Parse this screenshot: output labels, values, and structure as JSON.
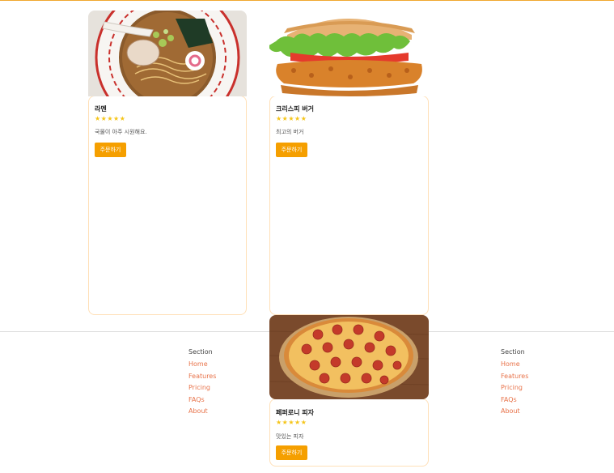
{
  "cards": [
    {
      "name": "라멘",
      "rating": "★★★★★",
      "description": "국물이 아주 시원해요.",
      "button": "주문하기"
    },
    {
      "name": "크리스피 버거",
      "rating": "★★★★★",
      "description": "최고의 버거",
      "button": "주문하기"
    },
    {
      "name": "페퍼로니 피자",
      "rating": "★★★★★",
      "description": "맛있는 피자",
      "button": "주문하기"
    }
  ],
  "footer": {
    "columns": [
      {
        "heading": "Section",
        "links": [
          "Home",
          "Features",
          "Pricing",
          "FAQs",
          "About"
        ]
      },
      {
        "heading": "Section",
        "links": [
          "Home",
          "Features",
          "Pricing",
          "FAQs",
          "About"
        ]
      }
    ]
  },
  "colors": {
    "accent": "#f59f00",
    "link": "#e8734a",
    "card_border": "#ffe0b8",
    "star": "#f5c518"
  }
}
